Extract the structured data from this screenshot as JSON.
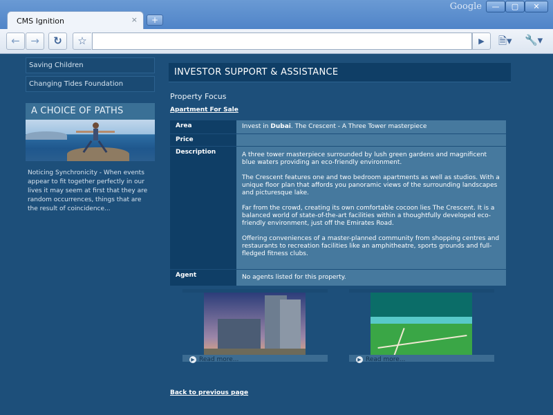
{
  "window": {
    "brand": "Google",
    "tab_title": "CMS Ignition",
    "tab_close_glyph": "×",
    "new_tab_glyph": "+",
    "minimize_glyph": "—",
    "maximize_glyph": "▢",
    "close_glyph": "✕"
  },
  "toolbar": {
    "back_icon": "arrow-left-icon",
    "forward_icon": "arrow-right-icon",
    "reload_icon": "reload-icon",
    "star_icon": "star-icon",
    "address_value": "",
    "go_icon": "play-icon",
    "page_menu_icon": "page-icon",
    "tools_menu_icon": "wrench-icon"
  },
  "sidebar": {
    "links": [
      {
        "label": "Saving Children"
      },
      {
        "label": "Changing Tides Foundation"
      }
    ],
    "paths_heading": "A CHOICE OF PATHS",
    "paths_text": "Noticing Synchronicity - When events appear to fit together perfectly in our lives it may seem at first that they are random occurrences, things that are the result of coincidence..."
  },
  "main": {
    "heading": "INVESTOR SUPPORT & ASSISTANCE",
    "focus_label": "Property Focus",
    "apartment_link": "Apartment For Sale",
    "table": {
      "area_label": "Area",
      "area_prefix": "Invest in ",
      "area_city": "Dubai",
      "area_suffix": ". The Crescent - A Three Tower masterpiece",
      "price_label": "Price",
      "price_value": "",
      "description_label": "Description",
      "description_paragraphs": [
        "A three tower masterpiece surrounded by lush green gardens and magnificent blue waters providing an eco-friendly environment.",
        "The Crescent features one and two bedroom apartments as well as studios. With a unique floor plan that affords you panoramic views of the surrounding landscapes and picturesque lake.",
        "Far from the crowd, creating its own comfortable cocoon lies The Crescent. It is a balanced world of state-of-the-art facilities within a thoughtfully developed eco-friendly environment, just off the Emirates Road.",
        "Offering conveniences of a master-planned community from shopping centres and restaurants to recreation facilities like an amphitheatre, sports grounds and full-fledged fitness clubs."
      ],
      "agent_label": "Agent",
      "agent_value": "No agents listed for this property."
    },
    "thumbnails": [
      {
        "read_more": "Read more..."
      },
      {
        "read_more": "Read more..."
      }
    ],
    "back_link": "Back to previous page"
  }
}
